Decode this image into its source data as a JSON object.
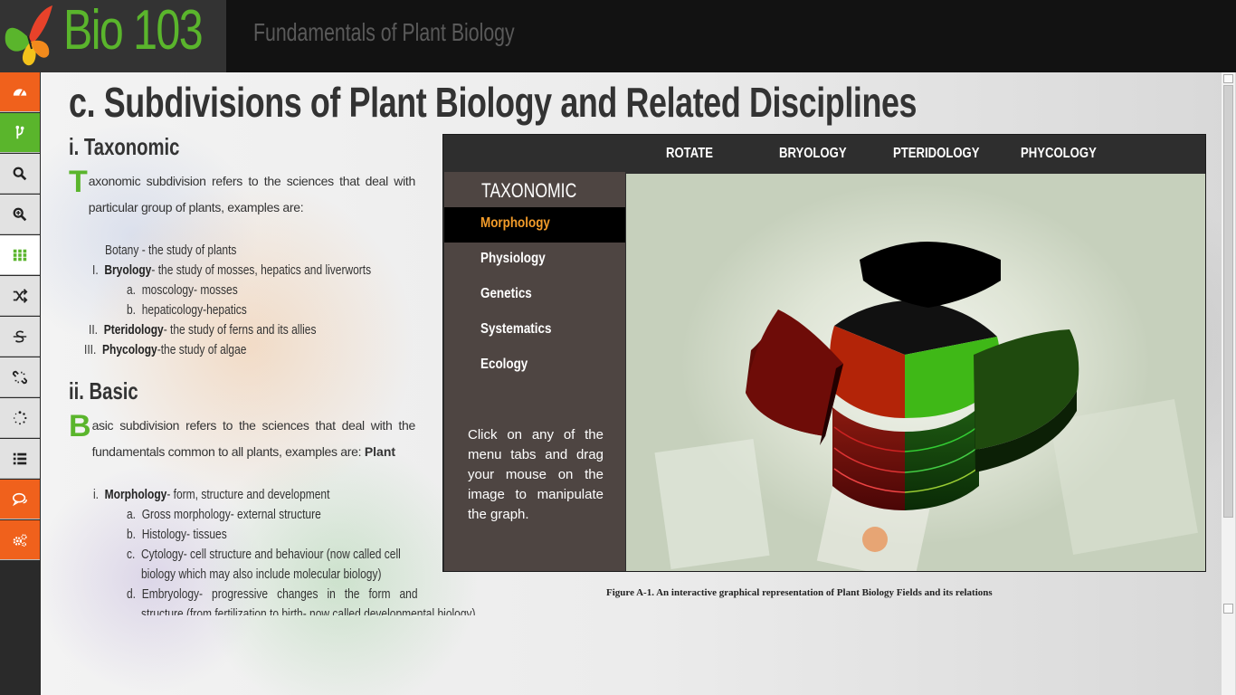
{
  "header": {
    "brand": "Bio 103",
    "subtitle": "Fundamentals of Plant Biology"
  },
  "rail": {
    "items": [
      {
        "icon": "dashboard-icon",
        "color": "orange"
      },
      {
        "icon": "branch-icon",
        "color": "green"
      },
      {
        "icon": "search-icon",
        "color": "light"
      },
      {
        "icon": "zoom-in-icon",
        "color": "light"
      },
      {
        "icon": "grid-icon",
        "color": "white"
      },
      {
        "icon": "shuffle-icon",
        "color": "light"
      },
      {
        "icon": "strikethrough-icon",
        "color": "light"
      },
      {
        "icon": "unlink-icon",
        "color": "light"
      },
      {
        "icon": "spinner-icon",
        "color": "light"
      },
      {
        "icon": "list-icon",
        "color": "light"
      },
      {
        "icon": "comments-icon",
        "color": "orange"
      },
      {
        "icon": "settings-icon",
        "color": "orange"
      }
    ]
  },
  "page": {
    "title": "c. Subdivisions of Plant Biology and Related Disciplines",
    "taxonomic": {
      "heading": "i. Taxonomic",
      "dropcap": "T",
      "intro": "axonomic subdivision refers to the sciences that deal with particular group of plants, examples are:",
      "botany": "Botany - the study of plants",
      "items": [
        {
          "num": "I.",
          "term": "Bryology",
          "desc": "- the study of mosses, hepatics and liverworts"
        },
        {
          "num": "a.",
          "term": "",
          "desc": "moscology- mosses"
        },
        {
          "num": "b.",
          "term": "",
          "desc": "hepaticology-hepatics"
        },
        {
          "num": "II.",
          "term": "Pteridology",
          "desc": "- the study of ferns and its allies"
        },
        {
          "num": "III.",
          "term": "Phycology",
          "desc": "-the study of algae"
        }
      ]
    },
    "basic": {
      "heading": "ii. Basic",
      "dropcap": "B",
      "intro": "asic subdivision refers to the sciences that deal with the fundamentals common to all plants, examples are: ",
      "intro_bold": "Plant",
      "items": [
        {
          "num": "i.",
          "term": "Morphology",
          "desc": "- form, structure and development"
        },
        {
          "num": "a.",
          "term": "",
          "desc": "Gross morphology- external structure"
        },
        {
          "num": "b.",
          "term": "",
          "desc": "Histology- tissues"
        },
        {
          "num": "c.",
          "term": "",
          "desc": "Cytology- cell structure and behaviour (now called cell"
        },
        {
          "num": "",
          "term": "",
          "desc": "biology which may also include molecular biology)"
        },
        {
          "num": "d.",
          "term": "",
          "desc": "Embryology-   progressive   changes   in   the   form   and"
        },
        {
          "num": "",
          "term": "",
          "desc": "structure (from fertilization to birth- now called developmental biology)"
        }
      ]
    }
  },
  "panel": {
    "tabs": [
      "ROTATE",
      "BRYOLOGY",
      "PTERIDOLOGY",
      "PHYCOLOGY"
    ],
    "side_title": "TAXONOMIC",
    "side_items": [
      "Morphology",
      "Physiology",
      "Genetics",
      "Systematics",
      "Ecology"
    ],
    "active_item": "Morphology",
    "note": "Click on any of the menu tabs and drag your mouse on the image to manipulate the graph.",
    "caption": "Figure A-1. An interactive graphical representation of Plant Biology Fields and its relations"
  },
  "colors": {
    "brand_green": "#5ab52c",
    "accent_orange": "#f0611c",
    "active_menu_text": "#f39c2a",
    "panel_side_bg": "#4e4542"
  }
}
